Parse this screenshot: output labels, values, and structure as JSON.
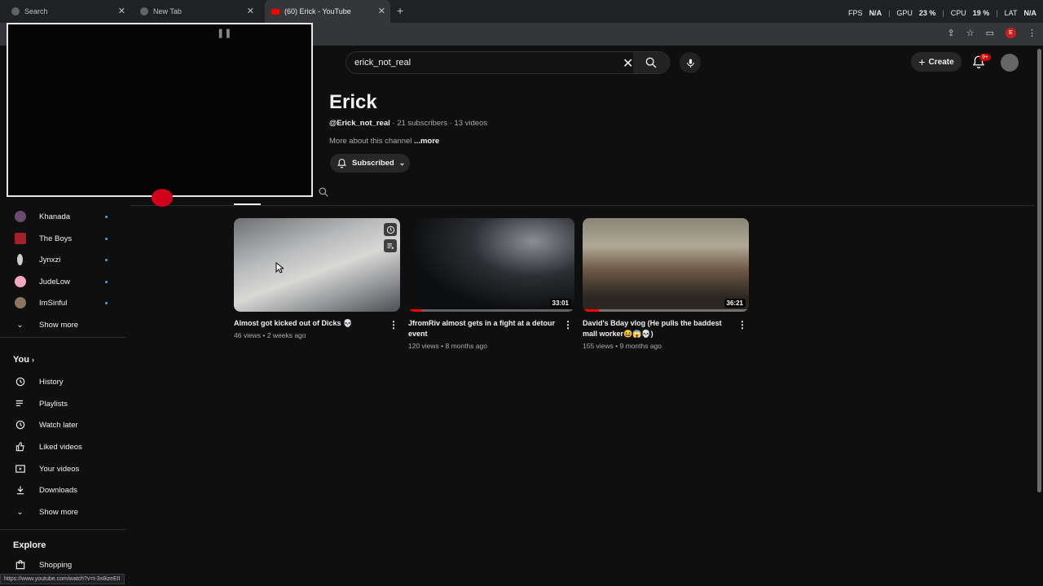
{
  "browser": {
    "tabs": [
      {
        "title": "Search"
      },
      {
        "title": "New Tab"
      },
      {
        "title": "(60) Erick - YouTube"
      }
    ],
    "new_tab": "+",
    "perf": {
      "fps_label": "FPS",
      "fps": "N/A",
      "gpu_label": "GPU",
      "gpu": "23 %",
      "cpu_label": "CPU",
      "cpu": "19 %",
      "lat_label": "LAT",
      "lat": "N/A"
    },
    "profile_letter": "E",
    "status_url": "https://www.youtube.com/watch?v=t-3x8izeEII"
  },
  "header": {
    "search_query": "erick_not_real",
    "create_label": "Create",
    "notification_badge": "9+"
  },
  "channel": {
    "name": "Erick",
    "handle": "@Erick_not_real",
    "meta": " · 21 subscribers · 13 videos",
    "about": "More about this channel ",
    "more": "...more",
    "subscribe_label": "Subscribed"
  },
  "videos": [
    {
      "title": "Almost got kicked out of Dicks 💀",
      "meta": "46 views • 2 weeks ago",
      "duration": "",
      "progress": 0
    },
    {
      "title": "JfromRiv almost gets in a fight at a detour event",
      "meta": "120 views • 8 months ago",
      "duration": "33:01",
      "progress": 0.08
    },
    {
      "title": "David's Bday vlog (He pulls the baddest mall worker😆😱💀)",
      "meta": "155 views • 9 months ago",
      "duration": "36:21",
      "progress": 0.1
    }
  ],
  "sidebar": {
    "subscriptions": [
      {
        "label": "Khanada",
        "color": "#6a4a6f"
      },
      {
        "label": "The Boys",
        "color": "#a31f2a"
      },
      {
        "label": "Jynxzi",
        "color": "#cccccc"
      },
      {
        "label": "JudeLow",
        "color": "#f2a7c3"
      },
      {
        "label": "ImSinful",
        "color": "#8a7560"
      }
    ],
    "show_more_1": "Show more",
    "you_heading": "You",
    "you_items": [
      {
        "label": "History",
        "icon": "history-icon"
      },
      {
        "label": "Playlists",
        "icon": "playlists-icon"
      },
      {
        "label": "Watch later",
        "icon": "watch-later-icon"
      },
      {
        "label": "Liked videos",
        "icon": "thumbs-up-icon"
      },
      {
        "label": "Your videos",
        "icon": "your-videos-icon"
      },
      {
        "label": "Downloads",
        "icon": "download-icon"
      }
    ],
    "show_more_2": "Show more",
    "explore_heading": "Explore",
    "explore_items": [
      {
        "label": "Shopping",
        "icon": "shopping-bag-icon"
      }
    ]
  }
}
